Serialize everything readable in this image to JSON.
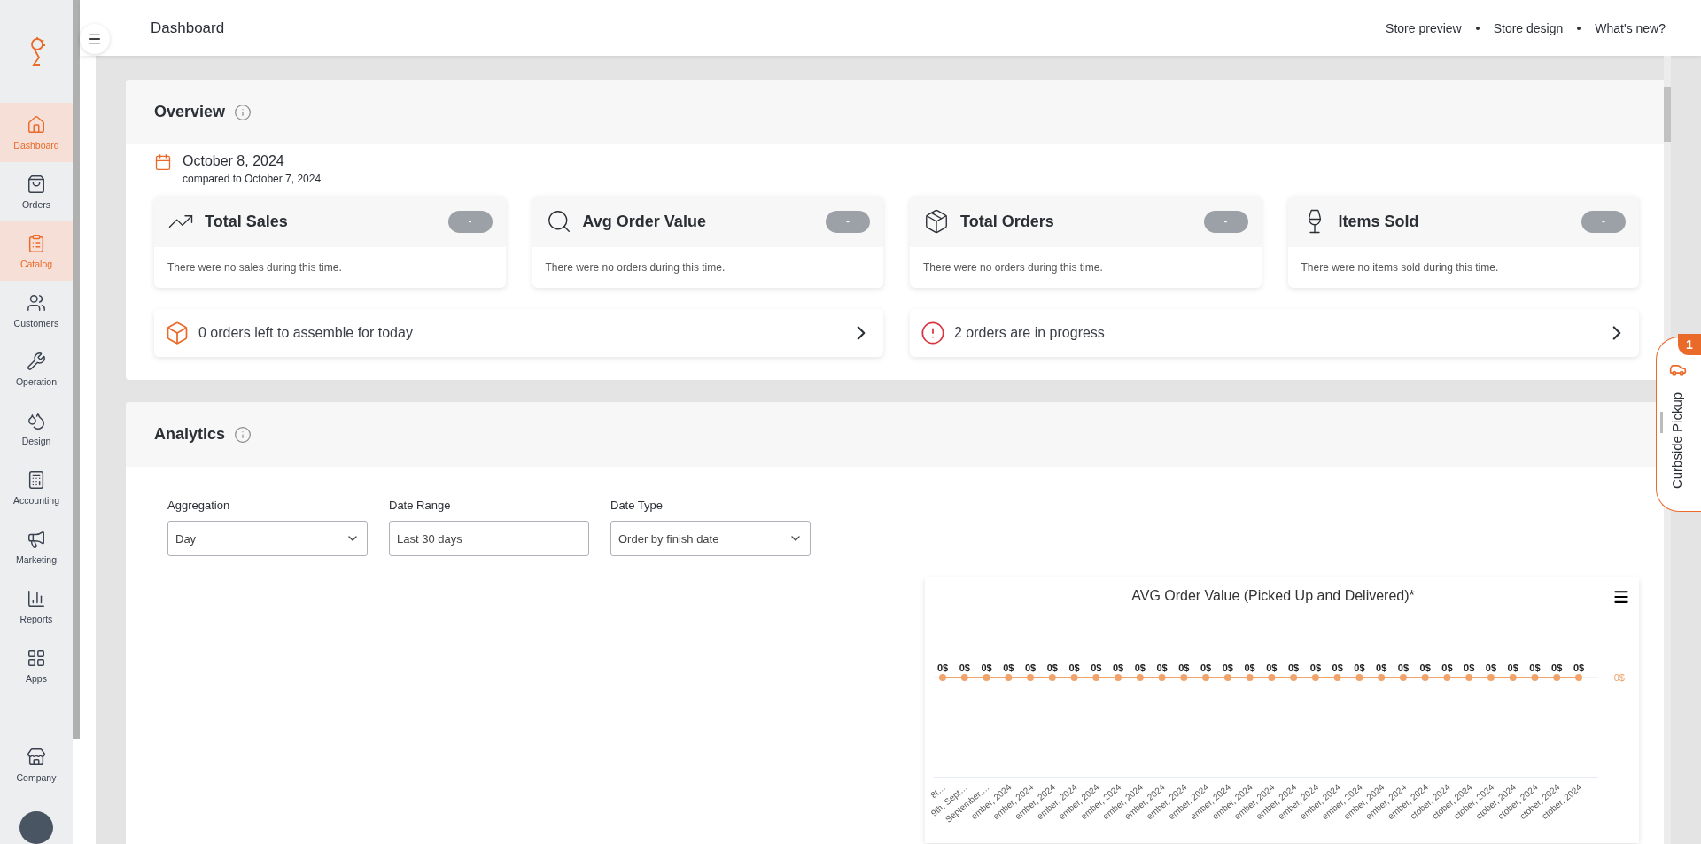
{
  "sidebar": {
    "items": [
      {
        "label": "Dashboard",
        "selected": true
      },
      {
        "label": "Orders",
        "selected": false
      },
      {
        "label": "Catalog",
        "selected": true
      },
      {
        "label": "Customers",
        "selected": false
      },
      {
        "label": "Operation",
        "selected": false
      },
      {
        "label": "Design",
        "selected": false
      },
      {
        "label": "Accounting",
        "selected": false
      },
      {
        "label": "Marketing",
        "selected": false
      },
      {
        "label": "Reports",
        "selected": false
      },
      {
        "label": "Apps",
        "selected": false
      }
    ],
    "footer_items": [
      {
        "label": "Company",
        "selected": false
      }
    ]
  },
  "topbar": {
    "title": "Dashboard",
    "links": [
      "Store preview",
      "Store design",
      "What's new?"
    ]
  },
  "overview": {
    "title": "Overview",
    "date": "October 8, 2024",
    "compared": "compared to October 7, 2024",
    "stats": [
      {
        "title": "Total Sales",
        "badge": "-",
        "message": "There were no sales during this time."
      },
      {
        "title": "Avg Order Value",
        "badge": "-",
        "message": "There were no orders during this time."
      },
      {
        "title": "Total Orders",
        "badge": "-",
        "message": "There were no orders during this time."
      },
      {
        "title": "Items Sold",
        "badge": "-",
        "message": "There were no items sold during this time."
      }
    ],
    "alerts": [
      {
        "kind": "box",
        "text": "0 orders left to assemble for today"
      },
      {
        "kind": "warning",
        "text": "2 orders are in progress"
      }
    ]
  },
  "analytics": {
    "title": "Analytics",
    "filters": [
      {
        "label": "Aggregation",
        "kind": "select",
        "value": "Day"
      },
      {
        "label": "Date Range",
        "kind": "input",
        "value": "Last 30 days"
      },
      {
        "label": "Date Type",
        "kind": "select",
        "value": "Order by finish date"
      }
    ],
    "chart": {
      "axis_reading": "0$",
      "title": "AVG Order Value (Picked Up and Delivered)*",
      "x_labels": [
        "8t…",
        "9th, Sept…",
        "September,…",
        "ember, 2024",
        "ember, 2024",
        "ember, 2024",
        "ember, 2024",
        "ember, 2024",
        "ember, 2024",
        "ember, 2024",
        "ember, 2024",
        "ember, 2024",
        "ember, 2024",
        "ember, 2024",
        "ember, 2024",
        "ember, 2024",
        "ember, 2024",
        "ember, 2024",
        "ember, 2024",
        "ember, 2024",
        "ember, 2024",
        "ember, 2024",
        "ember, 2024",
        "ctober, 2024",
        "ctober, 2024",
        "ctober, 2024",
        "ctober, 2024",
        "ctober, 2024",
        "ctober, 2024",
        "ctober, 2024"
      ],
      "point_labels": [
        "0$",
        "0$",
        "0$",
        "0$",
        "0$",
        "0$",
        "0$",
        "0$",
        "0$",
        "0$",
        "0$",
        "0$",
        "0$",
        "0$",
        "0$",
        "0$",
        "0$",
        "0$",
        "0$",
        "0$",
        "0$",
        "0$",
        "0$",
        "0$",
        "0$",
        "0$",
        "0$",
        "0$",
        "0$",
        "0$"
      ]
    }
  },
  "curbside": {
    "label": "Curbside Pickup",
    "badge": "1"
  }
}
